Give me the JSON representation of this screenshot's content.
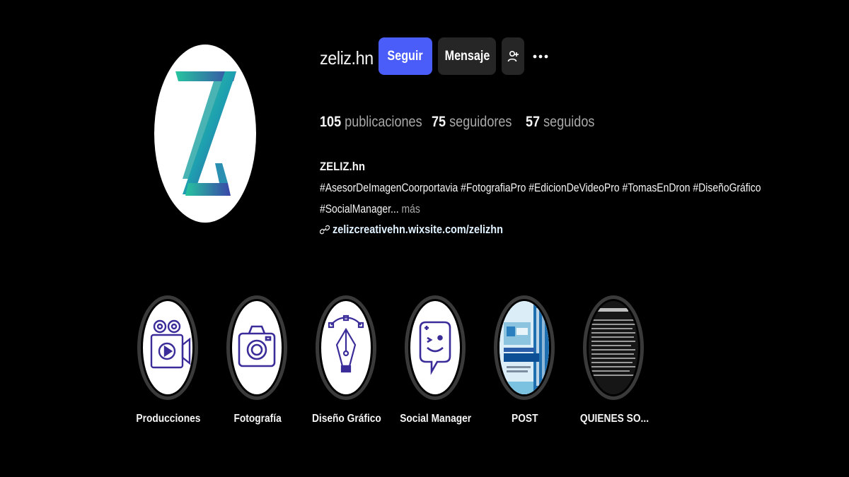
{
  "profile": {
    "username": "zeliz.hn",
    "follow_label": "Seguir",
    "message_label": "Mensaje",
    "add_user_icon": "person-plus-icon",
    "more_icon": "more-horizontal-icon",
    "avatar_icon": "zeliz-logo",
    "accent_color": "#4a5df9"
  },
  "stats": [
    {
      "value": "105",
      "label": "publicaciones"
    },
    {
      "value": "75",
      "label": "seguidores"
    },
    {
      "value": "57",
      "label": "seguidos"
    }
  ],
  "bio": {
    "name": "ZELIZ.hn",
    "line1": "#AsesorDeImagenCoorportavia #FotografiaPro #EdicionDeVideoPro #TomasEnDron #DiseñoGráfico",
    "line2": "#SocialManager...",
    "more_label": "más",
    "link_icon": "link-icon",
    "link": "zelizcreativehn.wixsite.com/zelizhn"
  },
  "highlights": [
    {
      "label": "Producciones",
      "icon": "video-camera-icon"
    },
    {
      "label": "Fotografía",
      "icon": "photo-camera-icon"
    },
    {
      "label": "Diseño Gráfico",
      "icon": "pen-tool-icon"
    },
    {
      "label": "Social Manager",
      "icon": "chat-smile-icon"
    },
    {
      "label": "POST",
      "icon": "community-manager-post"
    },
    {
      "label": "QUIENES SO...",
      "icon": "about-us-text"
    }
  ]
}
